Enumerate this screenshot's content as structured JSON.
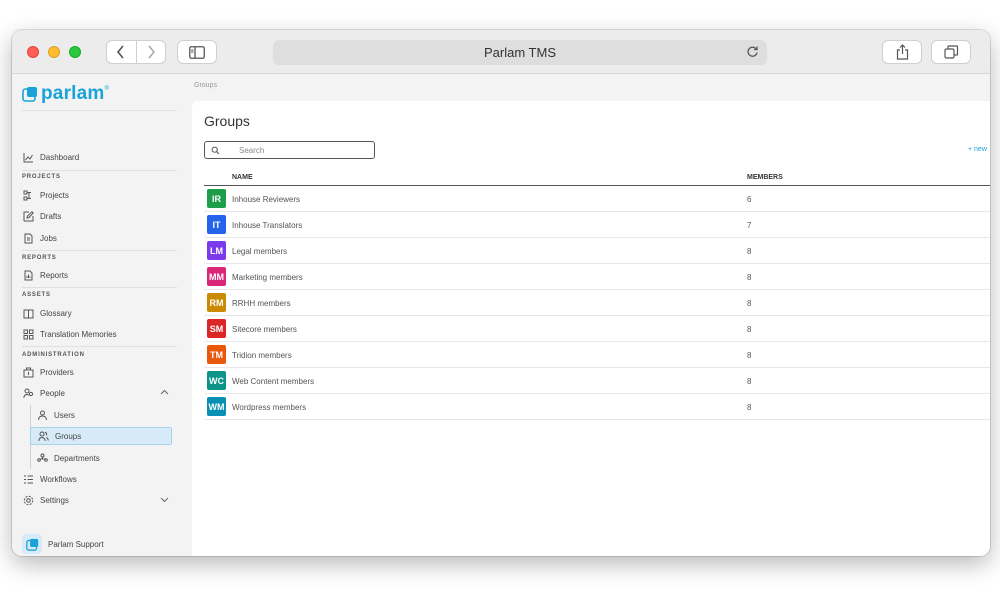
{
  "browser": {
    "title": "Parlam TMS"
  },
  "brand": {
    "name": "parlam",
    "trademark": "®",
    "accent": "#1aa3d9"
  },
  "sidebar": {
    "dashboard": "Dashboard",
    "sections": {
      "projects": "PROJECTS",
      "reports": "REPORTS",
      "assets": "ASSETS",
      "administration": "ADMINISTRATION"
    },
    "items": {
      "projects": "Projects",
      "drafts": "Drafts",
      "jobs": "Jobs",
      "reports": "Reports",
      "glossary": "Glossary",
      "translation_memories": "Translation Memories",
      "providers": "Providers",
      "people": "People",
      "users": "Users",
      "groups": "Groups",
      "departments": "Departments",
      "workflows": "Workflows",
      "settings": "Settings"
    },
    "support": "Parlam Support"
  },
  "breadcrumb": "Groups",
  "page": {
    "title": "Groups",
    "search_placeholder": "Search",
    "new_link": "+ new"
  },
  "table": {
    "columns": [
      "NAME",
      "MEMBERS"
    ],
    "rows": [
      {
        "initials": "IR",
        "name": "Inhouse Reviewers",
        "members": "6",
        "color": "#1e9e4a"
      },
      {
        "initials": "IT",
        "name": "Inhouse Translators",
        "members": "7",
        "color": "#2563eb"
      },
      {
        "initials": "LM",
        "name": "Legal members",
        "members": "8",
        "color": "#7c3aed"
      },
      {
        "initials": "MM",
        "name": "Marketing members",
        "members": "8",
        "color": "#db2777"
      },
      {
        "initials": "RM",
        "name": "RRHH members",
        "members": "8",
        "color": "#ca8a04"
      },
      {
        "initials": "SM",
        "name": "Sitecore members",
        "members": "8",
        "color": "#dc2626"
      },
      {
        "initials": "TM",
        "name": "Tridion members",
        "members": "8",
        "color": "#ea580c"
      },
      {
        "initials": "WC",
        "name": "Web Content members",
        "members": "8",
        "color": "#0d9488"
      },
      {
        "initials": "WM",
        "name": "Wordpress members",
        "members": "8",
        "color": "#0891b2"
      }
    ]
  }
}
